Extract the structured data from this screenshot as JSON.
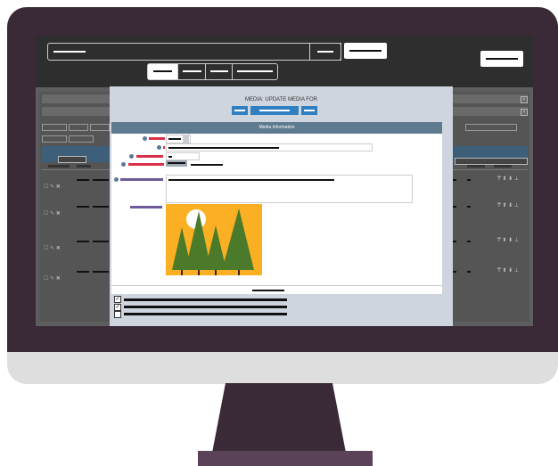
{
  "monitor": {
    "colors": {
      "bezel": "#3a2a38",
      "chin": "#dedede",
      "stand": "#3a2a38",
      "screen_top": "#2e2e2e",
      "screen_bg": "#5e5e5e",
      "modal_bg": "#ffffff",
      "modal_header": "#5e7a8e",
      "accent_blue": "#2f7fc1",
      "red": "#d9304a",
      "purple": "#6e5a9a",
      "sky": "#fbb024",
      "tree": "#4b7a2a"
    }
  },
  "modal": {
    "title": "MEDIA: UPDATE MEDIA FOR",
    "section_header": "Media Information",
    "checkboxes": [
      {
        "checked": true
      },
      {
        "checked": true
      },
      {
        "checked": false
      }
    ]
  },
  "icons": {
    "image": "landscape-image-icon",
    "sun": "sun-icon",
    "trees": "pine-trees-icon",
    "close": "close-icon"
  }
}
